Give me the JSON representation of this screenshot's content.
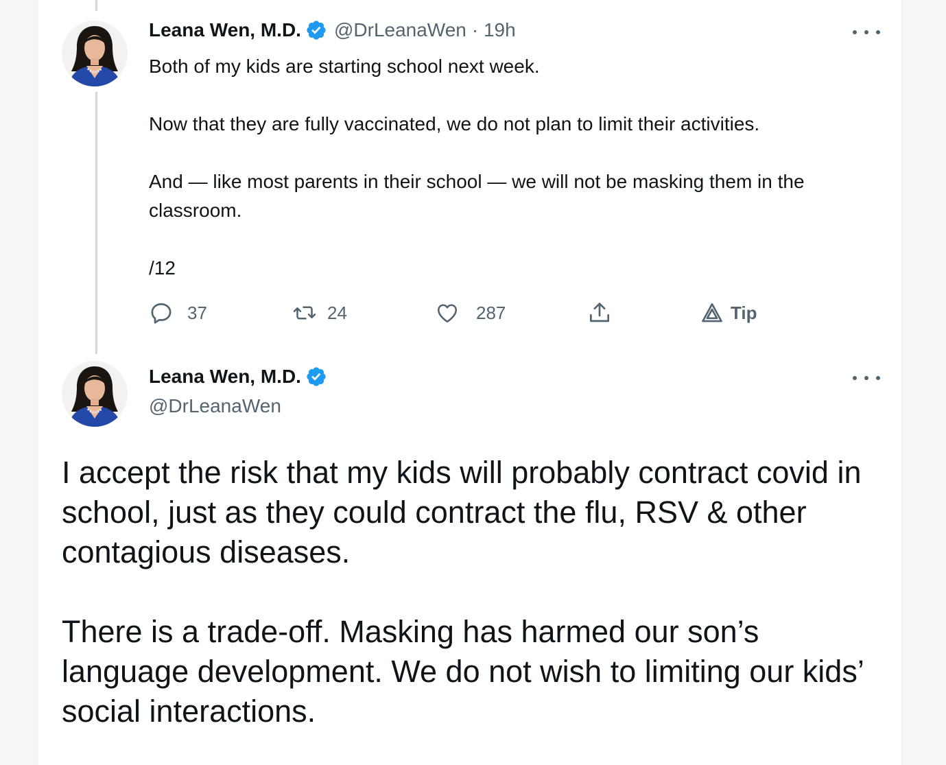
{
  "colors": {
    "text_primary": "#0f1419",
    "text_secondary": "#536471",
    "verified_blue": "#1d9bf0",
    "thread_line": "#cfd9de"
  },
  "tweet1": {
    "display_name": "Leana Wen, M.D.",
    "verified_icon": "verified-badge-icon",
    "handle": "@DrLeanaWen",
    "time": "· 19h",
    "paragraphs": [
      "Both of my kids are starting school next week.",
      "Now that they are fully vaccinated, we do not plan to limit their activities.",
      "And — like most parents in their school — we will not be masking them in the classroom.",
      "/12"
    ],
    "actions": {
      "reply_count": "37",
      "retweet_count": "24",
      "like_count": "287",
      "tip_label": "Tip"
    }
  },
  "tweet2": {
    "display_name": "Leana Wen, M.D.",
    "verified_icon": "verified-badge-icon",
    "handle": "@DrLeanaWen",
    "paragraphs": [
      "I accept the risk that my kids will probably contract covid in school, just as they could contract the flu, RSV & other contagious diseases.",
      "There is a trade-off. Masking has harmed our son’s language development. We do not wish to limiting our kids’ social interactions."
    ]
  }
}
